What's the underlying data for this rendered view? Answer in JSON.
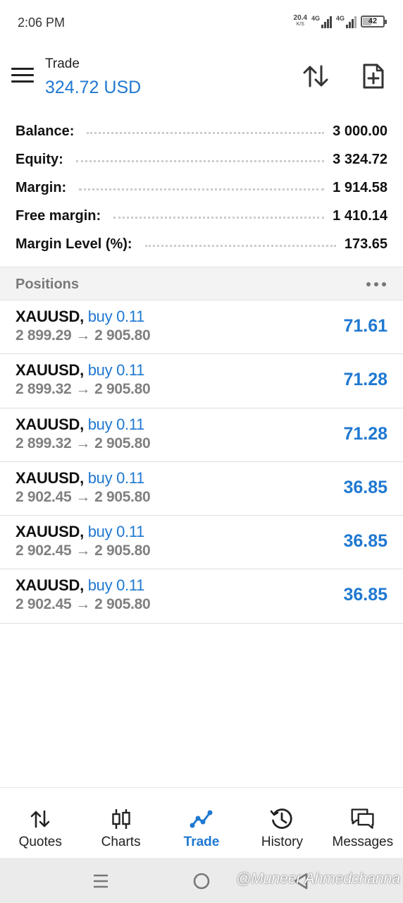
{
  "status_bar": {
    "time": "2:06 PM",
    "net_speed": "20.4",
    "net_unit": "K/S",
    "signal1_label": "4G",
    "signal2_label": "4G",
    "battery": "42"
  },
  "header": {
    "title": "Trade",
    "profit": "324.72 USD"
  },
  "summary": [
    {
      "label": "Balance:",
      "value": "3 000.00"
    },
    {
      "label": "Equity:",
      "value": "3 324.72"
    },
    {
      "label": "Margin:",
      "value": "1 914.58"
    },
    {
      "label": "Free margin:",
      "value": "1 410.14"
    },
    {
      "label": "Margin Level (%):",
      "value": "173.65"
    }
  ],
  "positions": {
    "title": "Positions",
    "rows": [
      {
        "symbol": "XAUUSD,",
        "direction": "buy 0.11",
        "open_price": "2 899.29",
        "arrow": "→",
        "current_price": "2 905.80",
        "profit": "71.61"
      },
      {
        "symbol": "XAUUSD,",
        "direction": "buy 0.11",
        "open_price": "2 899.32",
        "arrow": "→",
        "current_price": "2 905.80",
        "profit": "71.28"
      },
      {
        "symbol": "XAUUSD,",
        "direction": "buy 0.11",
        "open_price": "2 899.32",
        "arrow": "→",
        "current_price": "2 905.80",
        "profit": "71.28"
      },
      {
        "symbol": "XAUUSD,",
        "direction": "buy 0.11",
        "open_price": "2 902.45",
        "arrow": "→",
        "current_price": "2 905.80",
        "profit": "36.85"
      },
      {
        "symbol": "XAUUSD,",
        "direction": "buy 0.11",
        "open_price": "2 902.45",
        "arrow": "→",
        "current_price": "2 905.80",
        "profit": "36.85"
      },
      {
        "symbol": "XAUUSD,",
        "direction": "buy 0.11",
        "open_price": "2 902.45",
        "arrow": "→",
        "current_price": "2 905.80",
        "profit": "36.85"
      }
    ]
  },
  "bottom_nav": [
    {
      "label": "Quotes",
      "icon": "quotes-arrows-icon"
    },
    {
      "label": "Charts",
      "icon": "candlestick-icon"
    },
    {
      "label": "Trade",
      "icon": "trade-line-icon",
      "active": true
    },
    {
      "label": "History",
      "icon": "history-clock-icon"
    },
    {
      "label": "Messages",
      "icon": "chat-bubbles-icon"
    }
  ],
  "watermark": "@Muneer Ahmedchanna",
  "colors": {
    "accent_blue": "#1f78d1",
    "muted_gray": "#808080"
  }
}
